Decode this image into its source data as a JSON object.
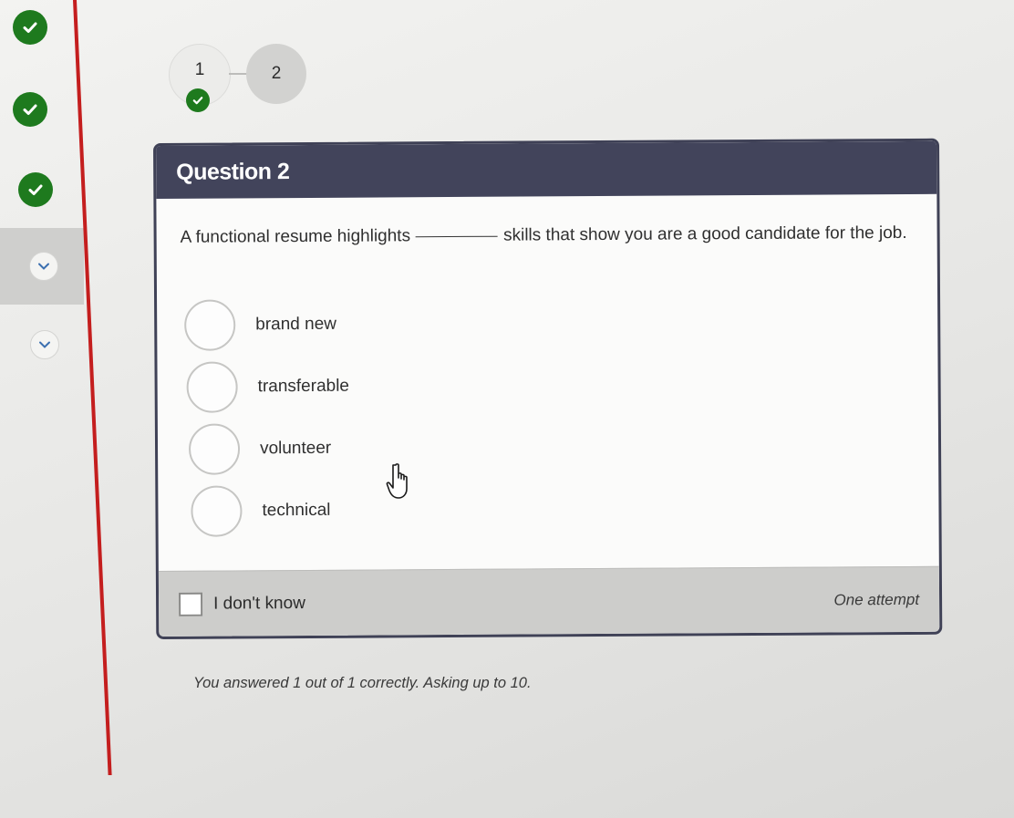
{
  "sidebar": {
    "items": [
      {
        "icon": "check-icon",
        "state": "completed"
      },
      {
        "icon": "check-icon",
        "state": "completed"
      },
      {
        "icon": "check-icon",
        "state": "completed"
      },
      {
        "icon": "chevron-down-icon",
        "state": "active"
      },
      {
        "icon": "chevron-down-icon",
        "state": "upcoming"
      }
    ]
  },
  "stepper": {
    "steps": [
      {
        "label": "1",
        "completed": true
      },
      {
        "label": "2",
        "completed": false
      }
    ]
  },
  "question": {
    "title": "Question 2",
    "prompt_before": "A functional resume highlights",
    "prompt_after": "skills that show you are a good candidate for the job.",
    "options": [
      {
        "label": "brand new"
      },
      {
        "label": "transferable"
      },
      {
        "label": "volunteer"
      },
      {
        "label": "technical"
      }
    ],
    "idk_label": "I don't know",
    "attempt_note": "One attempt"
  },
  "summary": "You answered 1 out of 1 correctly. Asking up to 10.",
  "colors": {
    "header": "#42445b",
    "success": "#1e7a1e",
    "rule": "#c41e1e"
  }
}
